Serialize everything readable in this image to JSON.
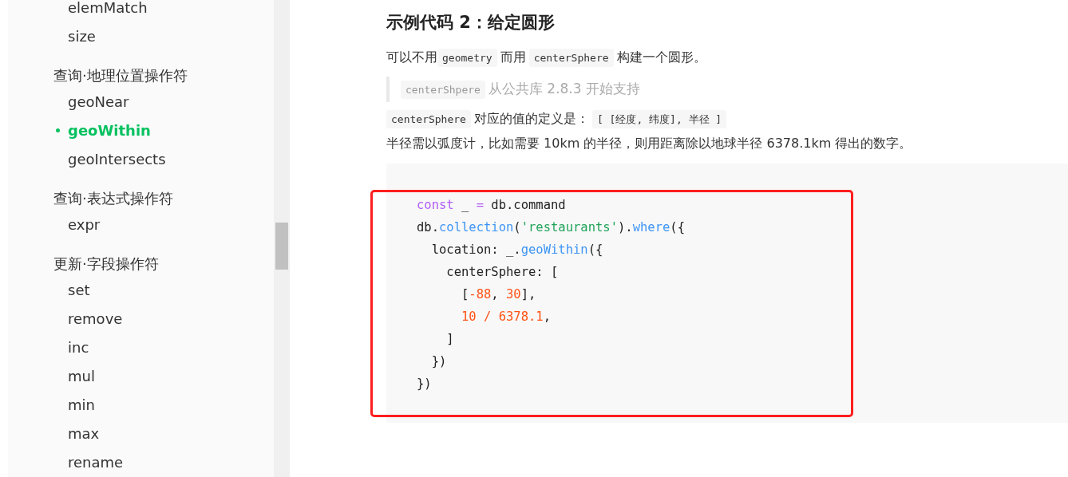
{
  "sidebar": {
    "groups": [
      {
        "items": [
          {
            "label": "elemMatch",
            "selected": false
          },
          {
            "label": "size",
            "selected": false
          }
        ]
      },
      {
        "heading": "查询·地理位置操作符",
        "items": [
          {
            "label": "geoNear",
            "selected": false
          },
          {
            "label": "geoWithin",
            "selected": true
          },
          {
            "label": "geoIntersects",
            "selected": false
          }
        ]
      },
      {
        "heading": "查询·表达式操作符",
        "items": [
          {
            "label": "expr",
            "selected": false
          }
        ]
      },
      {
        "heading": "更新·字段操作符",
        "items": [
          {
            "label": "set",
            "selected": false
          },
          {
            "label": "remove",
            "selected": false
          },
          {
            "label": "inc",
            "selected": false
          },
          {
            "label": "mul",
            "selected": false
          },
          {
            "label": "min",
            "selected": false
          },
          {
            "label": "max",
            "selected": false
          },
          {
            "label": "rename",
            "selected": false
          }
        ]
      }
    ]
  },
  "content": {
    "title": "示例代码 2：给定圆形",
    "blocks": [
      {
        "kind": "paragraph",
        "segments": [
          {
            "kind": "text",
            "text": "可以不用"
          },
          {
            "kind": "code",
            "text": "geometry"
          },
          {
            "kind": "text",
            "text": "而用"
          },
          {
            "kind": "code",
            "text": "centerSphere"
          },
          {
            "kind": "text",
            "text": "构建一个圆形。"
          }
        ]
      },
      {
        "kind": "quote",
        "segments": [
          {
            "kind": "code",
            "text": "centerShpere"
          },
          {
            "kind": "text",
            "text": "从公共库 2.8.3 开始支持"
          }
        ]
      },
      {
        "kind": "paragraph",
        "segments": [
          {
            "kind": "code",
            "text": "centerSphere"
          },
          {
            "kind": "text",
            "text": "对应的值的定义是："
          },
          {
            "kind": "code",
            "text": "[ [经度, 纬度], 半径 ]"
          }
        ]
      },
      {
        "kind": "paragraph",
        "segments": [
          {
            "kind": "text",
            "text": "半径需以弧度计，比如需要 10km 的半径，则用距离除以地球半径 6378.1km 得出的数字。"
          }
        ]
      }
    ],
    "code_block": {
      "highlighted": true,
      "lines": [
        [
          {
            "kind": "keyword",
            "text": "const"
          },
          {
            "kind": "plain",
            "text": " _ "
          },
          {
            "kind": "keyword",
            "text": "="
          },
          {
            "kind": "plain",
            "text": " db.command"
          }
        ],
        [
          {
            "kind": "plain",
            "text": "db."
          },
          {
            "kind": "function",
            "text": "collection"
          },
          {
            "kind": "plain",
            "text": "("
          },
          {
            "kind": "string",
            "text": "'restaurants'"
          },
          {
            "kind": "plain",
            "text": ")."
          },
          {
            "kind": "function",
            "text": "where"
          },
          {
            "kind": "plain",
            "text": "({"
          }
        ],
        [
          {
            "kind": "plain",
            "text": "  location: _."
          },
          {
            "kind": "function",
            "text": "geoWithin"
          },
          {
            "kind": "plain",
            "text": "({"
          }
        ],
        [
          {
            "kind": "plain",
            "text": "    centerSphere: ["
          }
        ],
        [
          {
            "kind": "plain",
            "text": "      ["
          },
          {
            "kind": "number",
            "text": "-88"
          },
          {
            "kind": "plain",
            "text": ", "
          },
          {
            "kind": "number",
            "text": "30"
          },
          {
            "kind": "plain",
            "text": "],"
          }
        ],
        [
          {
            "kind": "number",
            "text": "      10 / 6378.1"
          },
          {
            "kind": "plain",
            "text": ","
          }
        ],
        [
          {
            "kind": "plain",
            "text": "    ]"
          }
        ],
        [
          {
            "kind": "plain",
            "text": "  })"
          }
        ],
        [
          {
            "kind": "plain",
            "text": "})"
          }
        ]
      ]
    }
  }
}
